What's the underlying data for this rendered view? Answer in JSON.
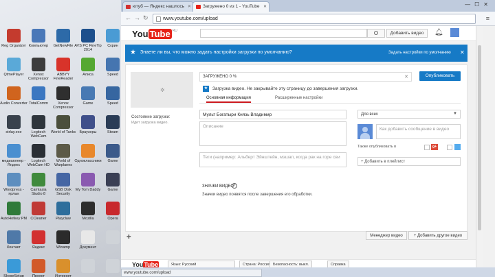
{
  "desktop": {
    "icons": [
      {
        "label": "Reg Organizer",
        "color": "#c43b2e"
      },
      {
        "label": "Компьютер",
        "color": "#4a78b8"
      },
      {
        "label": "GetNewFile",
        "color": "#2d6aa8"
      },
      {
        "label": "AVS PC FineTip 2014",
        "color": "#1d4f8c"
      },
      {
        "label": "Скрин",
        "color": "#4a9bd4"
      },
      {
        "label": "QtmePlayer",
        "color": "#5aa9d8"
      },
      {
        "label": "Xenox Compressor",
        "color": "#3c3c3c"
      },
      {
        "label": "ABBYY FineReader",
        "color": "#d8332a"
      },
      {
        "label": "Алиса",
        "color": "#55a832"
      },
      {
        "label": "Speed",
        "color": "#4575b0"
      },
      {
        "label": "Audio Converter",
        "color": "#d0641e"
      },
      {
        "label": "TotalComm",
        "color": "#3b77c1"
      },
      {
        "label": "Xenox Compressor",
        "color": "#2f2f2f"
      },
      {
        "label": "Game",
        "color": "#4879b3"
      },
      {
        "label": "Speed",
        "color": "#3666a0"
      },
      {
        "label": "strlay.exe",
        "color": "#39424d"
      },
      {
        "label": "Logitech WebCam",
        "color": "#2e353c"
      },
      {
        "label": "World of Tanks",
        "color": "#4b4f3c"
      },
      {
        "label": "Браузеры",
        "color": "#3f4f8a"
      },
      {
        "label": "Steam",
        "color": "#2a3c56"
      },
      {
        "label": "медиаплеер - Яндекс",
        "color": "#4a8fd0"
      },
      {
        "label": "Logitech WebCam HD",
        "color": "#2a2f35"
      },
      {
        "label": "World of Warplanes",
        "color": "#5c5a48"
      },
      {
        "label": "Одноклассники",
        "color": "#e8882c"
      },
      {
        "label": "Game",
        "color": "#3b5a8a"
      },
      {
        "label": "Wordpress - ярлык",
        "color": "#5d8ebf"
      },
      {
        "label": "Camtasia Studio 8",
        "color": "#3f8a3c"
      },
      {
        "label": "GSB Disk Security",
        "color": "#4566a4"
      },
      {
        "label": "My Tom Daddy",
        "color": "#8a5ab0"
      },
      {
        "label": "Game",
        "color": "#3a3f54"
      },
      {
        "label": "AutoHotkey PM",
        "color": "#2f7a3a"
      },
      {
        "label": "CCleaner",
        "color": "#c03a36"
      },
      {
        "label": "Playclaw",
        "color": "#2e6e9c"
      },
      {
        "label": "Mozilla",
        "color": "#2d2d2d"
      },
      {
        "label": "Opera",
        "color": "#c8282c"
      },
      {
        "label": "Контакт",
        "color": "#4f79a8"
      },
      {
        "label": "Яндекс",
        "color": "#d23030"
      },
      {
        "label": "Winamp",
        "color": "#2b2b2b"
      },
      {
        "label": "Документ",
        "color": "#e8e8e8"
      },
      {
        "label": "",
        "color": "#cfd3d8"
      },
      {
        "label": "SkypeSetup",
        "color": "#3a9ad8"
      },
      {
        "label": "Проект",
        "color": "#d25a2a"
      },
      {
        "label": "Интернет",
        "color": "#d9902c"
      },
      {
        "label": "",
        "color": "#cfd3d8"
      },
      {
        "label": "",
        "color": "#cfd3d8"
      }
    ]
  },
  "browser": {
    "tabs": [
      {
        "title": "ютуб — Яндекс нашлось",
        "favicon_color": "#d23030"
      },
      {
        "title": "Загружено 0 из 1 - YouTube",
        "favicon_color": "#e62117"
      }
    ],
    "address": "www.youtube.com/upload",
    "status_url": "www.youtube.com/upload"
  },
  "youtube": {
    "logo_you": "You",
    "logo_tube": "Tube",
    "region": "RU",
    "search_value": "",
    "add_video_label": "Добавить видео",
    "banner": {
      "text": "Знаете ли вы, что можно задать настройки загрузки по умолчанию?",
      "link": "Задать настройки по умолчанию",
      "color": "#167ac6"
    },
    "upload": {
      "status_label": "Состояние загрузки:",
      "status_value": "Идет загрузка видео.",
      "progress_text": "ЗАГРУЖЕНО 0 %",
      "progress_percent": 0,
      "publish_label": "Опубликовать",
      "notice": "Загрузка видео. Не закрывайте эту страницу до завершения загрузки.",
      "tabs": [
        "Основная информация",
        "Расширенные настройки"
      ],
      "title_value": "Мульт   Богатыри  Князь Владимир",
      "description_placeholder": "Описание",
      "tags_placeholder": "Теги (например: Альберт Эйнштейн, мэшап, когда рак на горе сви",
      "privacy_value": "Для всех",
      "message_placeholder": "Как добавить сообщение в видео",
      "share_label": "Также опубликовать в",
      "playlist_label": "+ Добавить в плейлист",
      "badges_label": "ЗНАЧКИ ВИДЕО",
      "badges_note": "Значки видео появятся после завершения его обработки."
    },
    "bottom": {
      "manager_label": "Менеджер видео",
      "another_label": "+ Добавить другое видео"
    },
    "footer": {
      "language": "Язык: Русский",
      "country": "Страна: Россия",
      "safety": "Безопасность: выкл.",
      "help": "Справка"
    }
  }
}
